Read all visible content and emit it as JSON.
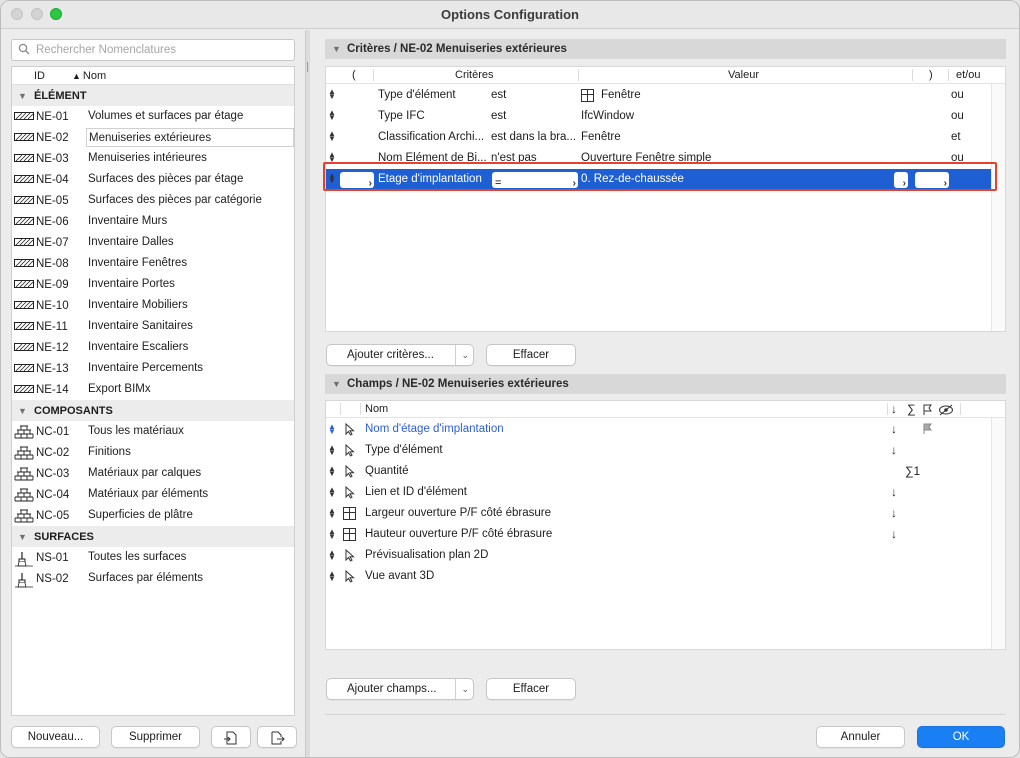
{
  "window": {
    "title": "Options Configuration"
  },
  "left": {
    "search_placeholder": "Rechercher Nomenclatures",
    "col_id": "ID",
    "col_nom": "Nom",
    "sort_indicator": "▲",
    "groups": [
      {
        "label": "ÉLÉMENT",
        "icon": "hatched-wall-icon",
        "items": [
          {
            "id": "NE-01",
            "nom": "Volumes et surfaces par étage"
          },
          {
            "id": "NE-02",
            "nom": "Menuiseries extérieures",
            "selected": true
          },
          {
            "id": "NE-03",
            "nom": "Menuiseries intérieures"
          },
          {
            "id": "NE-04",
            "nom": "Surfaces des pièces par étage"
          },
          {
            "id": "NE-05",
            "nom": "Surfaces des pièces par catégorie"
          },
          {
            "id": "NE-06",
            "nom": "Inventaire Murs"
          },
          {
            "id": "NE-07",
            "nom": "Inventaire Dalles"
          },
          {
            "id": "NE-08",
            "nom": "Inventaire Fenêtres"
          },
          {
            "id": "NE-09",
            "nom": "Inventaire Portes"
          },
          {
            "id": "NE-10",
            "nom": "Inventaire Mobiliers"
          },
          {
            "id": "NE-11",
            "nom": "Inventaire Sanitaires"
          },
          {
            "id": "NE-12",
            "nom": "Inventaire Escaliers"
          },
          {
            "id": "NE-13",
            "nom": "Inventaire Percements"
          },
          {
            "id": "NE-14",
            "nom": "Export BIMx"
          }
        ]
      },
      {
        "label": "COMPOSANTS",
        "icon": "bricks-icon",
        "items": [
          {
            "id": "NC-01",
            "nom": "Tous les matériaux"
          },
          {
            "id": "NC-02",
            "nom": "Finitions"
          },
          {
            "id": "NC-03",
            "nom": "Matériaux par calques"
          },
          {
            "id": "NC-04",
            "nom": "Matériaux par éléments"
          },
          {
            "id": "NC-05",
            "nom": "Superficies de plâtre"
          }
        ]
      },
      {
        "label": "SURFACES",
        "icon": "paint-brush-icon",
        "items": [
          {
            "id": "NS-01",
            "nom": "Toutes les surfaces"
          },
          {
            "id": "NS-02",
            "nom": "Surfaces par éléments"
          }
        ]
      }
    ],
    "buttons": {
      "new": "Nouveau...",
      "delete": "Supprimer"
    }
  },
  "criteria": {
    "title": "Critères / NE-02 Menuiseries extérieures",
    "headers": {
      "open_paren": "(",
      "criteria": "Critères",
      "value": "Valeur",
      "close_paren": ")",
      "andor": "et/ou"
    },
    "rows": [
      {
        "criterion": "Type d'élément",
        "operator": "est",
        "value": "Fenêtre",
        "value_icon": "window-icon",
        "andor": "ou"
      },
      {
        "criterion": "Type IFC",
        "operator": "est",
        "value": "IfcWindow",
        "andor": "ou"
      },
      {
        "criterion": "Classification Archi...",
        "operator": "est dans la bra...",
        "value": "Fenêtre",
        "andor": "et"
      },
      {
        "criterion": "Nom Élément de Bi...",
        "operator": "n'est pas",
        "value": "Ouverture Fenêtre simple",
        "andor": "ou"
      },
      {
        "criterion": "Étage d'implantation",
        "operator": "=",
        "value": "0. Rez-de-chaussée",
        "andor": "",
        "active": true
      }
    ],
    "add_button": "Ajouter critères...",
    "clear_button": "Effacer"
  },
  "fields": {
    "title": "Champs / NE-02 Menuiseries extérieures",
    "header_name": "Nom",
    "header_sort": "↓",
    "header_sum": "∑",
    "rows": [
      {
        "name": "Nom d'étage d'implantation",
        "icon": "pointer-icon",
        "sort": "↓",
        "sum": "",
        "flag": true,
        "highlight": true
      },
      {
        "name": "Type d'élément",
        "icon": "pointer-icon",
        "sort": "↓",
        "sum": ""
      },
      {
        "name": "Quantité",
        "icon": "pointer-icon",
        "sort": "",
        "sum": "∑1"
      },
      {
        "name": "Lien et ID d'élément",
        "icon": "pointer-icon",
        "sort": "↓",
        "sum": ""
      },
      {
        "name": "Largeur ouverture P/F côté ébrasure",
        "icon": "window-icon",
        "sort": "↓",
        "sum": ""
      },
      {
        "name": "Hauteur ouverture P/F côté ébrasure",
        "icon": "window-icon",
        "sort": "↓",
        "sum": ""
      },
      {
        "name": "Prévisualisation plan 2D",
        "icon": "pointer-icon",
        "sort": "",
        "sum": ""
      },
      {
        "name": "Vue avant 3D",
        "icon": "pointer-icon",
        "sort": "",
        "sum": ""
      }
    ],
    "add_button": "Ajouter champs...",
    "clear_button": "Effacer"
  },
  "footer": {
    "cancel": "Annuler",
    "ok": "OK"
  },
  "colors": {
    "accent": "#1e5fd3",
    "ok_button": "#1a7ff3",
    "highlight_box": "#e8402f",
    "field_highlight_text": "#2d5fd4"
  }
}
